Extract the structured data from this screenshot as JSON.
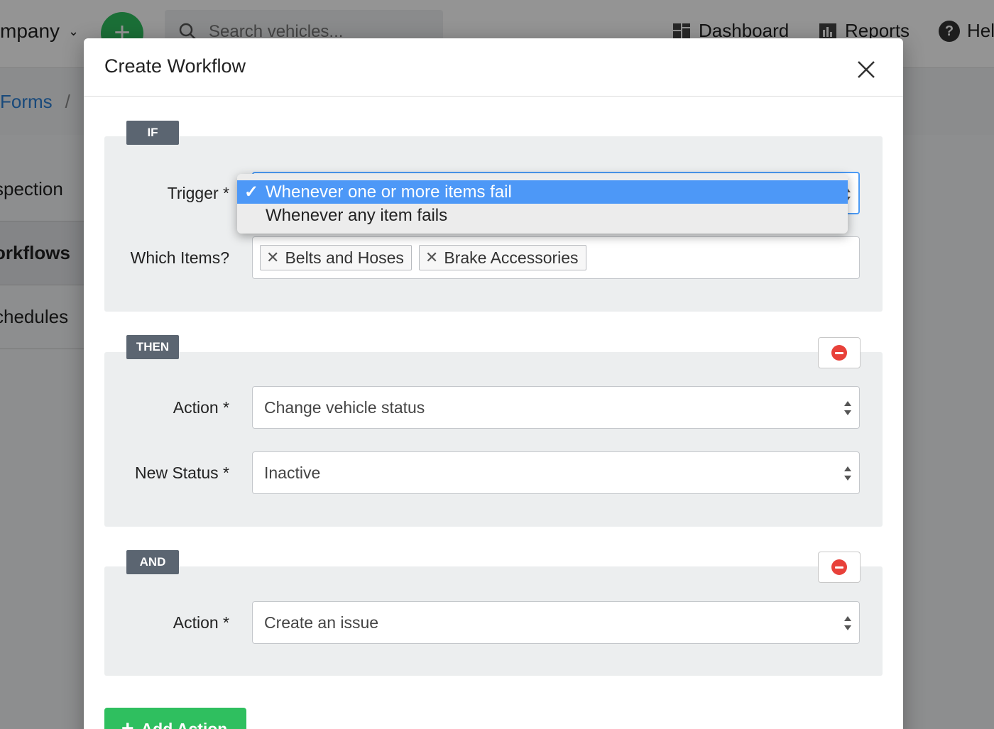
{
  "app": {
    "company_label": "mpany",
    "search_placeholder": "Search vehicles...",
    "nav": {
      "dashboard": "Dashboard",
      "reports": "Reports",
      "help": "Hel"
    }
  },
  "breadcrumb": {
    "forms": "Forms",
    "sep": "/"
  },
  "sidebar": {
    "items": [
      {
        "label": "spection"
      },
      {
        "label": "orkflows"
      },
      {
        "label": "chedules"
      }
    ]
  },
  "modal": {
    "title": "Create Workflow",
    "if_section": {
      "tag": "IF",
      "trigger_label": "Trigger *",
      "trigger_options": [
        {
          "label": "Whenever one or more items fail",
          "selected": true
        },
        {
          "label": "Whenever any item fails",
          "selected": false
        }
      ],
      "which_items_label": "Which Items?",
      "items": [
        "Belts and Hoses",
        "Brake Accessories"
      ]
    },
    "then_section": {
      "tag": "THEN",
      "action_label": "Action *",
      "action_value": "Change vehicle status",
      "new_status_label": "New Status *",
      "new_status_value": "Inactive"
    },
    "and_section": {
      "tag": "AND",
      "action_label": "Action *",
      "action_value": "Create an issue"
    },
    "add_action_label": "Add Action"
  },
  "colors": {
    "accent_green": "#2fbf5f",
    "selection_blue": "#4d98f7",
    "danger_red": "#e8413a",
    "tag_gray": "#5b6571"
  }
}
